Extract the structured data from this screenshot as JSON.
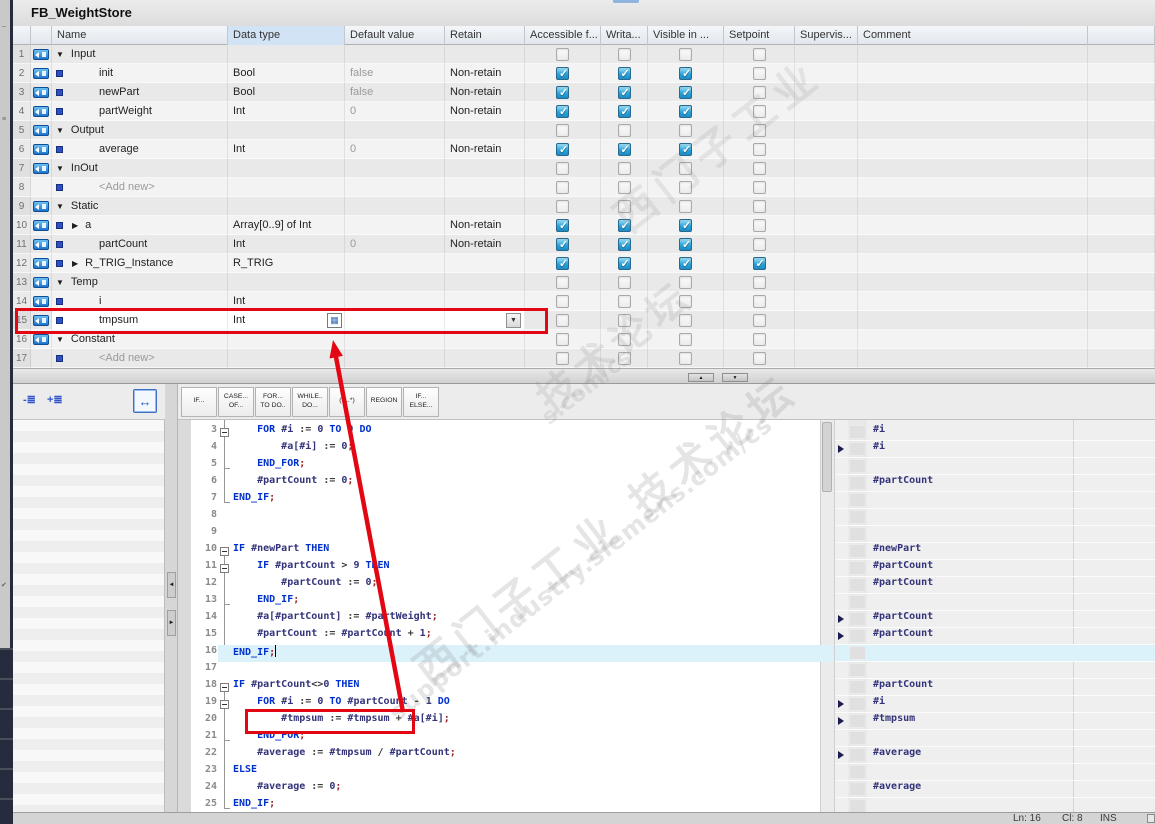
{
  "window": {
    "title": "FB_WeightStore"
  },
  "table": {
    "columns": [
      "",
      "",
      "Name",
      "Data type",
      "Default value",
      "Retain",
      "Accessible f...",
      "Writa...",
      "Visible in ...",
      "Setpoint",
      "Supervis...",
      "Comment",
      ""
    ],
    "rows": [
      {
        "num": "1",
        "kind": "section",
        "name": "Input",
        "checks": [
          false,
          false,
          false,
          false
        ]
      },
      {
        "num": "2",
        "kind": "var",
        "name": "init",
        "datatype": "Bool",
        "default": "false",
        "retain": "Non-retain",
        "checks": [
          true,
          true,
          true,
          false
        ]
      },
      {
        "num": "3",
        "kind": "var",
        "name": "newPart",
        "datatype": "Bool",
        "default": "false",
        "retain": "Non-retain",
        "checks": [
          true,
          true,
          true,
          false
        ]
      },
      {
        "num": "4",
        "kind": "var",
        "name": "partWeight",
        "datatype": "Int",
        "default": "0",
        "retain": "Non-retain",
        "checks": [
          true,
          true,
          true,
          false
        ]
      },
      {
        "num": "5",
        "kind": "section",
        "name": "Output",
        "checks": [
          false,
          false,
          false,
          false
        ]
      },
      {
        "num": "6",
        "kind": "var",
        "name": "average",
        "datatype": "Int",
        "default": "0",
        "retain": "Non-retain",
        "checks": [
          true,
          true,
          true,
          false
        ]
      },
      {
        "num": "7",
        "kind": "section",
        "name": "InOut",
        "checks": [
          false,
          false,
          false,
          false
        ]
      },
      {
        "num": "8",
        "kind": "addnew",
        "name": "<Add new>",
        "checks": [
          false,
          false,
          false,
          false
        ]
      },
      {
        "num": "9",
        "kind": "section",
        "name": "Static",
        "checks": [
          false,
          false,
          false,
          false
        ]
      },
      {
        "num": "10",
        "kind": "var",
        "expand": true,
        "name": "a",
        "datatype": "Array[0..9] of Int",
        "retain": "Non-retain",
        "checks": [
          true,
          true,
          true,
          false
        ]
      },
      {
        "num": "11",
        "kind": "var",
        "name": "partCount",
        "datatype": "Int",
        "default": "0",
        "retain": "Non-retain",
        "checks": [
          true,
          true,
          true,
          false
        ]
      },
      {
        "num": "12",
        "kind": "var",
        "expand": true,
        "name": "R_TRIG_Instance",
        "datatype": "R_TRIG",
        "checks": [
          true,
          true,
          true,
          true
        ]
      },
      {
        "num": "13",
        "kind": "section",
        "name": "Temp",
        "checks": [
          false,
          false,
          false,
          false
        ]
      },
      {
        "num": "14",
        "kind": "var",
        "name": "i",
        "datatype": "Int",
        "checks": [
          false,
          false,
          false,
          false
        ]
      },
      {
        "num": "15",
        "kind": "edit",
        "name": "tmpsum",
        "datatype": "Int",
        "checks": [
          false,
          false,
          false,
          false
        ]
      },
      {
        "num": "16",
        "kind": "section",
        "name": "Constant",
        "checks": [
          false,
          false,
          false,
          false
        ]
      },
      {
        "num": "17",
        "kind": "addnew",
        "name": "<Add new>",
        "checks": [
          false,
          false,
          false,
          false
        ]
      }
    ]
  },
  "splitter": {
    "up_icon": "▲",
    "down_icon": "▼"
  },
  "left_panel": {
    "toolbar_icons": [
      {
        "name": "collapse-list-icon",
        "glyph": "-≣"
      },
      {
        "name": "expand-list-icon",
        "glyph": "+≣"
      },
      {
        "name": "split-editor-icon",
        "glyph": "↔"
      }
    ]
  },
  "editor": {
    "toolbar": [
      [
        "IF..."
      ],
      [
        "CASE...",
        "OF..."
      ],
      [
        "FOR...",
        "TO DO.."
      ],
      [
        "WHILE..",
        "DO..."
      ],
      [
        "(*...*)"
      ],
      [
        "REGION"
      ],
      [
        "IF...",
        "ELSE..."
      ]
    ],
    "lines": [
      {
        "n": 3,
        "ind": 4,
        "fold": true,
        "t": [
          [
            "k",
            "FOR "
          ],
          [
            "v",
            "#i "
          ],
          [
            "o",
            ":= "
          ],
          [
            "n",
            "0 "
          ],
          [
            "k",
            "TO "
          ],
          [
            "n",
            "9 "
          ],
          [
            "k",
            "DO"
          ]
        ]
      },
      {
        "n": 4,
        "ind": 8,
        "t": [
          [
            "v",
            "#a[#i] "
          ],
          [
            "o",
            ":= "
          ],
          [
            "n",
            "0"
          ],
          [
            "s",
            ";"
          ]
        ]
      },
      {
        "n": 5,
        "ind": 4,
        "t": [
          [
            "k",
            "END_FOR"
          ],
          [
            "s",
            ";"
          ]
        ]
      },
      {
        "n": 6,
        "ind": 4,
        "t": [
          [
            "v",
            "#partCount "
          ],
          [
            "o",
            ":= "
          ],
          [
            "n",
            "0"
          ],
          [
            "s",
            ";"
          ]
        ]
      },
      {
        "n": 7,
        "ind": 0,
        "t": [
          [
            "k",
            "END_IF"
          ],
          [
            "s",
            ";"
          ]
        ]
      },
      {
        "n": 8,
        "ind": 0,
        "t": []
      },
      {
        "n": 9,
        "ind": 0,
        "t": []
      },
      {
        "n": 10,
        "ind": 0,
        "fold": true,
        "t": [
          [
            "k",
            "IF "
          ],
          [
            "v",
            "#newPart "
          ],
          [
            "k",
            "THEN"
          ]
        ]
      },
      {
        "n": 11,
        "ind": 4,
        "fold": true,
        "t": [
          [
            "k",
            "IF "
          ],
          [
            "v",
            "#partCount "
          ],
          [
            "o",
            "> "
          ],
          [
            "n",
            "9 "
          ],
          [
            "k",
            "THEN"
          ]
        ]
      },
      {
        "n": 12,
        "ind": 8,
        "t": [
          [
            "v",
            "#partCount "
          ],
          [
            "o",
            ":= "
          ],
          [
            "n",
            "0"
          ],
          [
            "s",
            ";"
          ]
        ]
      },
      {
        "n": 13,
        "ind": 4,
        "t": [
          [
            "k",
            "END_IF"
          ],
          [
            "s",
            ";"
          ]
        ]
      },
      {
        "n": 14,
        "ind": 4,
        "t": [
          [
            "v",
            "#a[#partCount] "
          ],
          [
            "o",
            ":= "
          ],
          [
            "v",
            "#partWeight"
          ],
          [
            "s",
            ";"
          ]
        ]
      },
      {
        "n": 15,
        "ind": 4,
        "t": [
          [
            "v",
            "#partCount "
          ],
          [
            "o",
            ":= "
          ],
          [
            "v",
            "#partCount "
          ],
          [
            "o",
            "+ "
          ],
          [
            "n",
            "1"
          ],
          [
            "s",
            ";"
          ]
        ]
      },
      {
        "n": 16,
        "ind": 0,
        "cur": true,
        "t": [
          [
            "k",
            "END_IF"
          ],
          [
            "s",
            ";"
          ]
        ]
      },
      {
        "n": 17,
        "ind": 0,
        "t": []
      },
      {
        "n": 18,
        "ind": 0,
        "fold": true,
        "t": [
          [
            "k",
            "IF "
          ],
          [
            "v",
            "#partCount"
          ],
          [
            "o",
            "<>"
          ],
          [
            "n",
            "0 "
          ],
          [
            "k",
            "THEN"
          ]
        ]
      },
      {
        "n": 19,
        "ind": 4,
        "fold": true,
        "t": [
          [
            "k",
            "FOR "
          ],
          [
            "v",
            "#i "
          ],
          [
            "o",
            ":= "
          ],
          [
            "n",
            "0 "
          ],
          [
            "k",
            "TO "
          ],
          [
            "v",
            "#partCount "
          ],
          [
            "o",
            "- "
          ],
          [
            "n",
            "1 "
          ],
          [
            "k",
            "DO"
          ]
        ]
      },
      {
        "n": 20,
        "ind": 8,
        "t": [
          [
            "v",
            "#tmpsum "
          ],
          [
            "o",
            ":= "
          ],
          [
            "v",
            "#tmpsum "
          ],
          [
            "o",
            "+ "
          ],
          [
            "v",
            "#a[#i]"
          ],
          [
            "s",
            ";"
          ]
        ]
      },
      {
        "n": 21,
        "ind": 4,
        "t": [
          [
            "k",
            "END_FOR"
          ],
          [
            "s",
            ";"
          ]
        ]
      },
      {
        "n": 22,
        "ind": 4,
        "t": [
          [
            "v",
            "#average "
          ],
          [
            "o",
            ":= "
          ],
          [
            "v",
            "#tmpsum "
          ],
          [
            "o",
            "/ "
          ],
          [
            "v",
            "#partCount"
          ],
          [
            "s",
            ";"
          ]
        ]
      },
      {
        "n": 23,
        "ind": 0,
        "t": [
          [
            "k",
            "ELSE"
          ]
        ]
      },
      {
        "n": 24,
        "ind": 4,
        "t": [
          [
            "v",
            "#average "
          ],
          [
            "o",
            ":= "
          ],
          [
            "n",
            "0"
          ],
          [
            "s",
            ";"
          ]
        ]
      },
      {
        "n": 25,
        "ind": 0,
        "t": [
          [
            "k",
            "END_IF"
          ],
          [
            "s",
            ";"
          ]
        ]
      }
    ],
    "brackets": [
      {
        "from": 3,
        "to": 7,
        "top": true
      },
      {
        "from": 3,
        "to": 5
      },
      {
        "from": 10,
        "to": 16
      },
      {
        "from": 11,
        "to": 13
      },
      {
        "from": 18,
        "to": 25
      },
      {
        "from": 19,
        "to": 21
      }
    ],
    "cursor_line": 16
  },
  "monitor": {
    "rows": [
      {
        "line": 3,
        "text": "#i"
      },
      {
        "line": 4,
        "text": "#i",
        "arrow": true
      },
      {
        "line": 6,
        "text": "#partCount"
      },
      {
        "line": 10,
        "text": "#newPart"
      },
      {
        "line": 11,
        "text": "#partCount"
      },
      {
        "line": 12,
        "text": "#partCount"
      },
      {
        "line": 14,
        "text": "#partCount",
        "arrow": true
      },
      {
        "line": 15,
        "text": "#partCount",
        "arrow": true
      },
      {
        "line": 18,
        "text": "#partCount"
      },
      {
        "line": 19,
        "text": "#i",
        "arrow": true
      },
      {
        "line": 20,
        "text": "#tmpsum",
        "arrow": true
      },
      {
        "line": 22,
        "text": "#average",
        "arrow": true
      },
      {
        "line": 24,
        "text": "#average"
      }
    ]
  },
  "status": {
    "line": "Ln: 16",
    "col": "Cl: 8",
    "mode": "INS"
  },
  "watermark": {
    "line1_cn": "西门子工业 技术论坛",
    "line2_en": "support.industry.siemens.com/cs",
    "frag_cn": "技术论坛",
    "frag_en": "s.com/cs",
    "frag_cn2": "西门子工业"
  },
  "icons": {
    "datatype_selector": "▦",
    "dropdown": "▼",
    "section_collapse": "▼",
    "row_expand": "▶"
  },
  "annotations": {
    "highlighted_table_row": 15,
    "highlighted_code_line": 20,
    "annotation_color": "#e30613"
  },
  "colors": {
    "keyword": "#0030cc",
    "variable": "#33337a",
    "punctuation": "#992222",
    "checkbox_blue": "#2aa4dd",
    "current_line": "#dcf2fb"
  }
}
